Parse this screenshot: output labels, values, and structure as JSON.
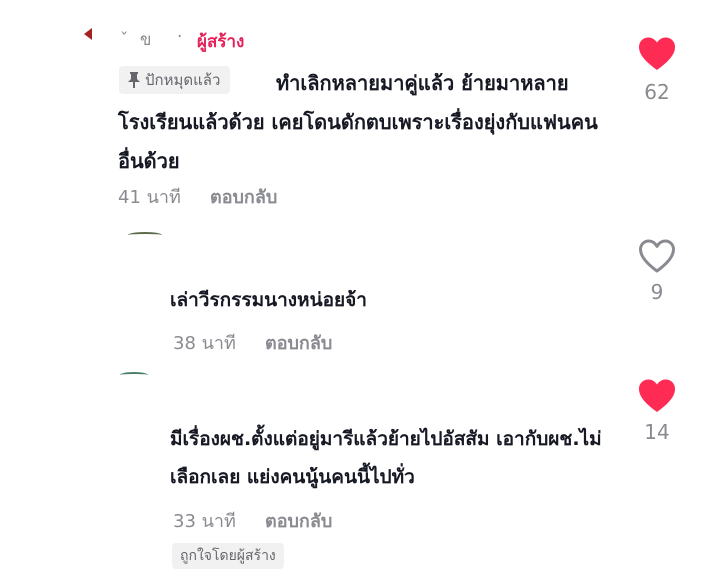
{
  "colors": {
    "accent": "#e3235a",
    "muted": "#8a8b91",
    "text": "#161823",
    "chip_bg": "#f1f1f2",
    "like_active": "#fe2c55"
  },
  "comments": [
    {
      "username": "ˇ ข",
      "separator": "·",
      "creator_label": "ผู้สร้าง",
      "pinned_label": "ปักหมุดแล้ว",
      "pin_icon": "pin-icon",
      "text": "ทำเลิกหลายมาคู่แล้ว ย้ายมาหลายโรงเรียนแล้วด้วย เคยโดนดักตบเพราะเรื่องยุ่งกับแฟนคนอื่นด้วย",
      "time": "41 นาที",
      "reply_label": "ตอบกลับ",
      "like_count": "62",
      "liked": true,
      "like_icon": "heart-filled-icon"
    },
    {
      "text": "เล่าวีรกรรมนางหน่อยจ้า",
      "time": "38 นาที",
      "reply_label": "ตอบกลับ",
      "like_count": "9",
      "liked": false,
      "like_icon": "heart-outline-icon"
    },
    {
      "text": "มีเรื่องผช.ตั้งแต่อยู่มารีแล้วย้ายไปอัสสัม เอากับผช.ไม่เลือกเลย แย่งคนนู้นคนนี้ไปทั่ว",
      "time": "33 นาที",
      "reply_label": "ตอบกลับ",
      "liked_by_creator": "ถูกใจโดยผู้สร้าง",
      "like_count": "14",
      "liked": true,
      "like_icon": "heart-filled-icon"
    }
  ]
}
